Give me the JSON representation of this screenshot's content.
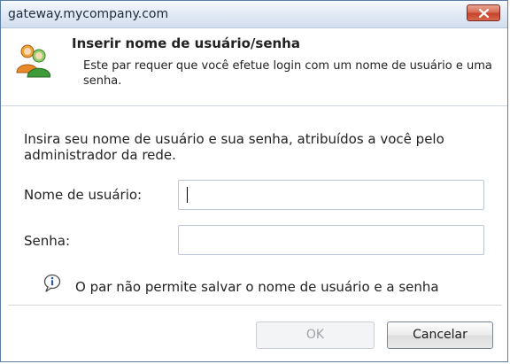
{
  "window": {
    "title": "gateway.mycompany.com"
  },
  "header": {
    "title": "Inserir nome de usuário/senha",
    "description": "Este par requer que você efetue login com um nome de usuário e uma senha."
  },
  "form": {
    "instructions": "Insira seu nome de usuário e sua senha, atribuídos a você pelo administrador da rede.",
    "username_label": "Nome de usuário:",
    "username_value": "",
    "password_label": "Senha:",
    "password_value": ""
  },
  "info": {
    "text": "O par não permite salvar o nome de usuário e a senha"
  },
  "buttons": {
    "ok_label": "OK",
    "cancel_label": "Cancelar"
  },
  "icons": {
    "close": "close-icon",
    "users": "users-icon",
    "info": "info-icon"
  }
}
